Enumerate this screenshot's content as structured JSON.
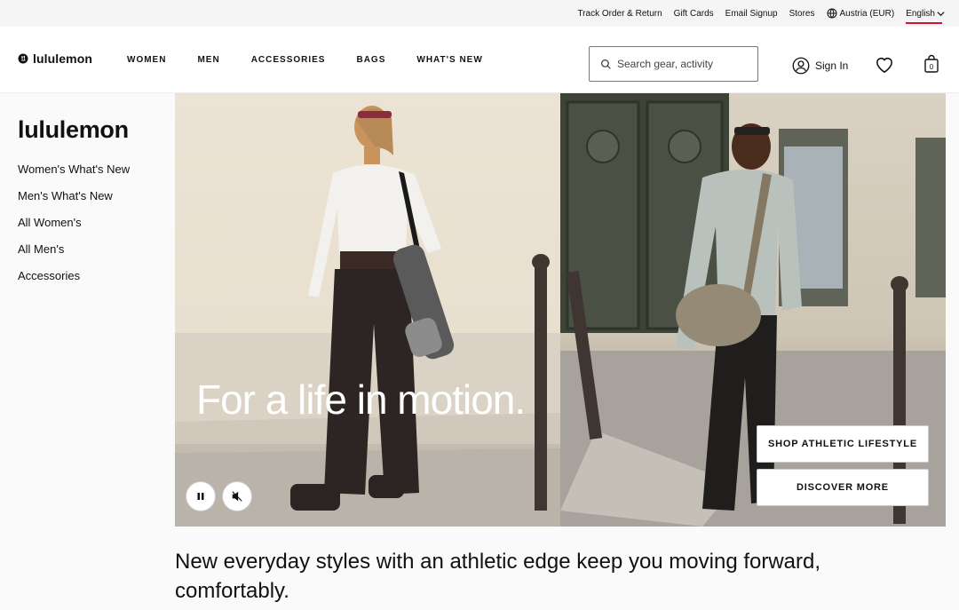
{
  "utility": {
    "track": "Track Order & Return",
    "gift": "Gift Cards",
    "email": "Email Signup",
    "stores": "Stores",
    "region": "Austria (EUR)",
    "language": "English"
  },
  "header": {
    "logo": "lululemon",
    "nav": [
      "WOMEN",
      "MEN",
      "ACCESSORIES",
      "BAGS",
      "WHAT'S NEW"
    ],
    "search_placeholder": "Search gear, activity",
    "signin": "Sign In",
    "bag_count": "0"
  },
  "sidebar": {
    "title": "lululemon",
    "items": [
      "Women's What's New",
      "Men's What's New",
      "All Women's",
      "All Men's",
      "Accessories"
    ]
  },
  "hero": {
    "title": "For a life in motion.",
    "cta_primary": "SHOP ATHLETIC LIFESTYLE",
    "cta_secondary": "DISCOVER MORE"
  },
  "tagline": "New everyday styles with an athletic edge keep you moving forward, comfortably.",
  "colors": {
    "accent": "#d31334"
  }
}
